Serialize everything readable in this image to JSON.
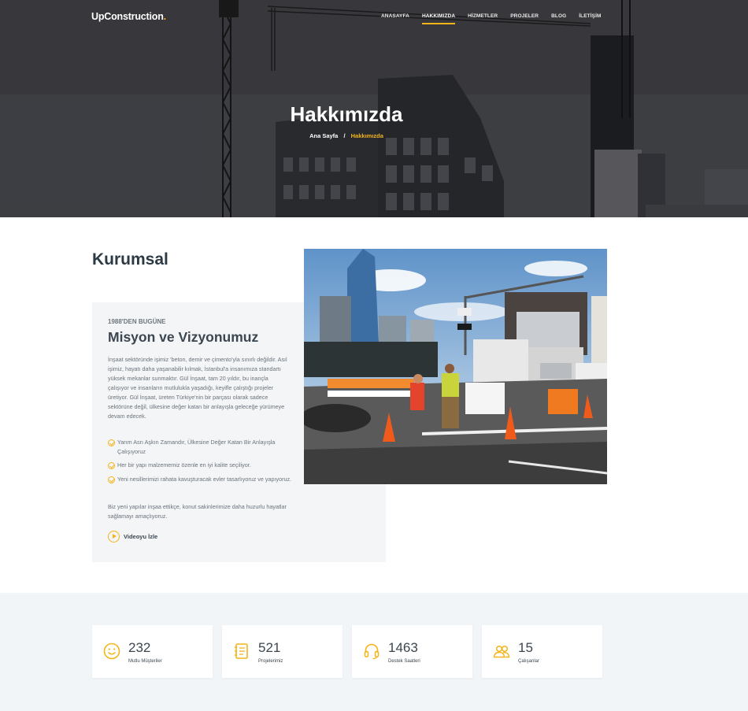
{
  "brand": {
    "name": "UpConstruction",
    "dot": ".",
    "accent": "#f4b41a"
  },
  "nav": [
    {
      "label": "ANASAYFA",
      "active": false
    },
    {
      "label": "HAKKIMIZDA",
      "active": true
    },
    {
      "label": "HİZMETLER",
      "active": false
    },
    {
      "label": "PROJELER",
      "active": false
    },
    {
      "label": "BLOG",
      "active": false
    },
    {
      "label": "İLETİŞİM",
      "active": false
    }
  ],
  "hero": {
    "title": "Hakkımızda",
    "breadcrumb": {
      "home": "Ana Sayfa",
      "separator": "/",
      "current": "Hakkımızda"
    }
  },
  "about": {
    "section_title": "Kurumsal",
    "eyebrow": "1988'DEN BUGÜNE",
    "heading": "Misyon ve Vizyonumuz",
    "paragraph": "İnşaat sektöründe işimiz 'beton, demir ve çimento'yla sınırlı değildir. Asıl işimiz, hayatı daha yaşanabilir kılmak, İstanbul'a insanımıza standartı yüksek mekanlar sunmaktır. Gül İnşaat, tam 20 yıldır, bu inançla çalışıyor ve insanların mutlulukla yaşadığı, keyifle çalıştığı projeler üretiyor. Gül İnşaat, üreten Türkiye'nin bir parçası olarak sadece sektörüne değil, ülkesine değer katan bir anlayışla geleceğe yürümeye devam edecek.",
    "checks": [
      "Yarım Asrı Aşkın Zamandır, Ülkesine Değer Katan Bir Anlayışla Çalışıyoruz",
      "Her bir yapı malzememiz özenle en iyi kalite seçiliyor.",
      "Yeni nesillerimizi rahata kavuşturacak evler tasarlıyoruz ve yapıyoruz."
    ],
    "paragraph2": "Biz yeni yapılar inşaa ettikçe, konut sakinlerimize daha huzurlu hayatlar sağlamayı amaçlıyoruz.",
    "video_label": "Videoyu İzle"
  },
  "stats": [
    {
      "value": "232",
      "label": "Mutlu Müşteriler",
      "icon": "smile-icon"
    },
    {
      "value": "521",
      "label": "Projelerimiz",
      "icon": "journal-icon"
    },
    {
      "value": "1463",
      "label": "Destek Saatleri",
      "icon": "headset-icon"
    },
    {
      "value": "15",
      "label": "Çalışanlar",
      "icon": "people-icon"
    }
  ]
}
